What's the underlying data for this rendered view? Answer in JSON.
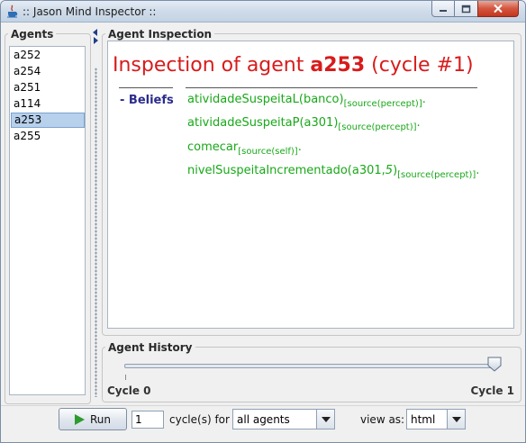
{
  "window": {
    "title": ":: Jason Mind Inspector ::"
  },
  "agents": {
    "legend": "Agents",
    "items": [
      "a252",
      "a254",
      "a251",
      "a114",
      "a253",
      "a255"
    ],
    "selected": "a253"
  },
  "inspection": {
    "legend": "Agent Inspection",
    "heading_prefix": "Inspection of agent ",
    "agent": "a253",
    "heading_suffix": " (cycle #1)",
    "beliefs_label": "- Beliefs",
    "beliefs": [
      {
        "literal": "atividadeSuspeitaL(banco)",
        "annotation": "[source(percept)]",
        "dot": "."
      },
      {
        "literal": "atividadeSuspeitaP(a301)",
        "annotation": "[source(percept)]",
        "dot": "."
      },
      {
        "literal": "comecar",
        "annotation": "[source(self)]",
        "dot": "."
      },
      {
        "literal": "nivelSuspeitaIncrementado(a301,",
        "literal_italic": "5",
        "literal_close": ")",
        "annotation": "[source(percept)]",
        "dot": "."
      }
    ]
  },
  "history": {
    "legend": "Agent History",
    "min_label": "Cycle 0",
    "max_label": "Cycle 1",
    "value": 1
  },
  "controls": {
    "run_label": "Run",
    "cycles_value": "1",
    "cycles_for_label": "cycle(s) for",
    "target_selected": "all agents",
    "view_as_label": "view as:",
    "view_selected": "html"
  },
  "colors": {
    "heading": "#d81b1b",
    "belief": "#18a818",
    "beliefs_label": "#2b2b8c",
    "selection": "#b7d0ec"
  }
}
